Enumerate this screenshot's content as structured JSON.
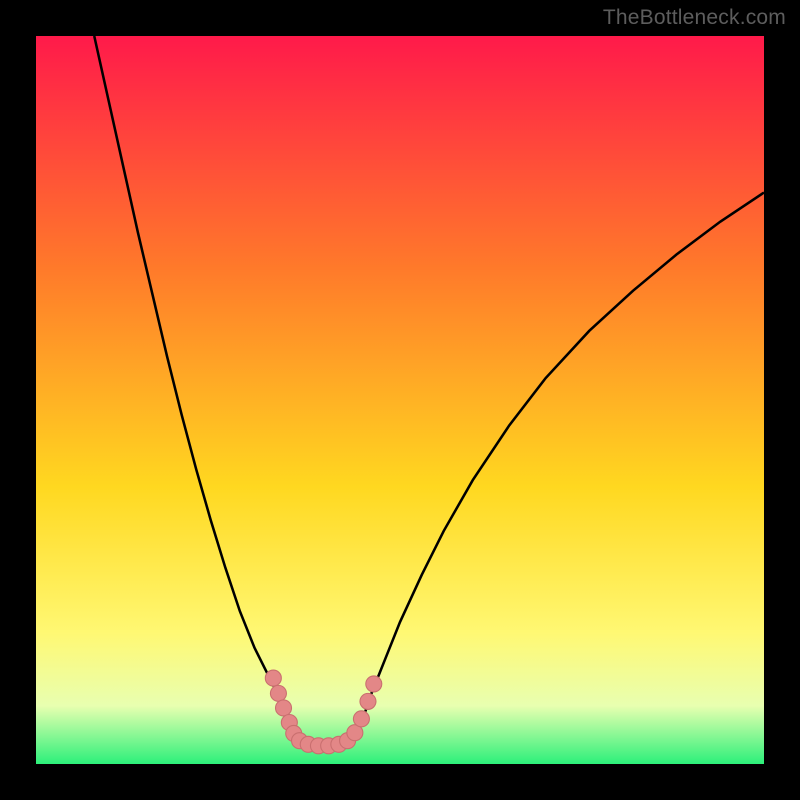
{
  "watermark": "TheBottleneck.com",
  "colors": {
    "frame": "#000000",
    "gradient_top": "#ff1a4a",
    "gradient_mid1": "#ff7a2a",
    "gradient_mid2": "#ffd820",
    "gradient_mid3": "#fff873",
    "gradient_mid4": "#e8ffb0",
    "gradient_bottom": "#2cf07a",
    "curve": "#000000",
    "marker_fill": "#e38787",
    "marker_stroke": "#c96f6f"
  },
  "chart_data": {
    "type": "line",
    "title": "",
    "xlabel": "",
    "ylabel": "",
    "xlim": [
      0,
      100
    ],
    "ylim": [
      0,
      100
    ],
    "note": "Values are percentages along each axis of the inner plot (0,0 = top-left of gradient area). Y increases downward so bottom green band ≈ 100.",
    "series": [
      {
        "name": "left-branch",
        "x": [
          8.0,
          10.0,
          12.0,
          14.0,
          16.0,
          18.0,
          20.0,
          22.0,
          24.0,
          26.0,
          28.0,
          30.0,
          32.0,
          33.0,
          34.0,
          35.25
        ],
        "y": [
          0.0,
          9.0,
          18.0,
          27.0,
          35.5,
          44.0,
          52.0,
          59.5,
          66.5,
          73.0,
          79.0,
          84.0,
          88.0,
          90.0,
          92.0,
          96.5
        ]
      },
      {
        "name": "floor",
        "x": [
          35.25,
          36.5,
          38.0,
          39.5,
          41.0,
          42.5,
          44.0
        ],
        "y": [
          96.5,
          97.3,
          97.6,
          97.7,
          97.6,
          97.3,
          96.5
        ]
      },
      {
        "name": "right-branch",
        "x": [
          44.0,
          46.0,
          48.0,
          50.0,
          53.0,
          56.0,
          60.0,
          65.0,
          70.0,
          76.0,
          82.0,
          88.0,
          94.0,
          100.0
        ],
        "y": [
          96.5,
          90.5,
          85.5,
          80.5,
          74.0,
          68.0,
          61.0,
          53.5,
          47.0,
          40.5,
          35.0,
          30.0,
          25.5,
          21.5
        ]
      }
    ],
    "markers": {
      "name": "highlight-cluster",
      "shape": "circle",
      "radius_pct": 1.1,
      "points_xy": [
        [
          32.6,
          88.2
        ],
        [
          33.3,
          90.3
        ],
        [
          34.0,
          92.3
        ],
        [
          34.8,
          94.3
        ],
        [
          35.4,
          95.8
        ],
        [
          36.2,
          96.8
        ],
        [
          37.4,
          97.3
        ],
        [
          38.8,
          97.5
        ],
        [
          40.2,
          97.5
        ],
        [
          41.6,
          97.3
        ],
        [
          42.8,
          96.8
        ],
        [
          43.8,
          95.7
        ],
        [
          44.7,
          93.8
        ],
        [
          45.6,
          91.4
        ],
        [
          46.4,
          89.0
        ]
      ]
    }
  }
}
